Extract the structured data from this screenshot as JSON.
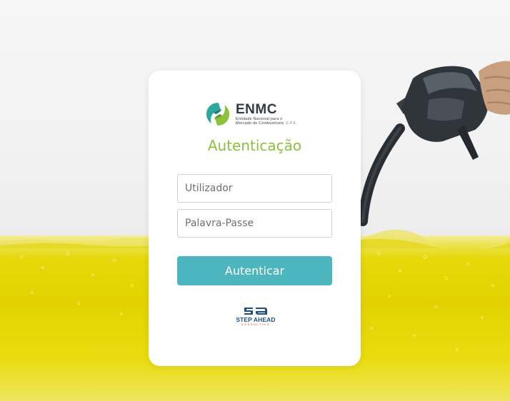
{
  "brand": {
    "name": "ENMC",
    "subtitle_line1": "Entidade Nacional para o",
    "subtitle_line2": "Mercado de Combustíveis",
    "subtitle_suffix": "E.P.E.",
    "logo_icon": "enmc-logo-icon"
  },
  "login": {
    "title": "Autenticação",
    "username_placeholder": "Utilizador",
    "password_placeholder": "Palavra-Passe",
    "submit_label": "Autenticar"
  },
  "partner": {
    "name": "STEP AHEAD",
    "subtitle": "CONSULTING",
    "logo_icon": "step-ahead-logo-icon"
  },
  "colors": {
    "accent_green": "#8cc13c",
    "button_teal": "#4db5be",
    "fuel_yellow": "#e3d200",
    "partner_blue": "#1f4e8c"
  }
}
